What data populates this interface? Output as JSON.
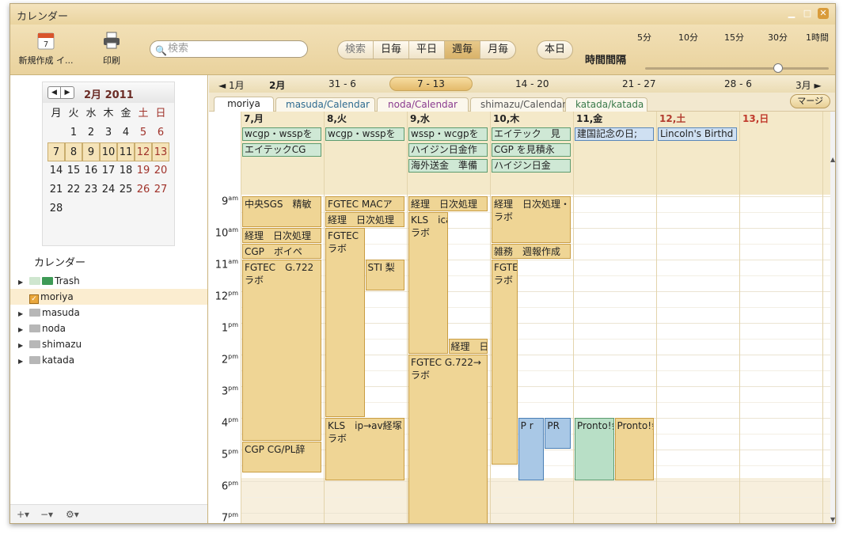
{
  "window": {
    "title": "カレンダー"
  },
  "toolbar": {
    "new_label": "新規作成 イ...",
    "new_icon_day": "7",
    "print_label": "印刷",
    "search_placeholder": "検索",
    "view_buttons": [
      "検索",
      "日毎",
      "平日",
      "週毎",
      "月毎"
    ],
    "active_view": "週毎",
    "today_label": "本日",
    "interval_label": "時間間隔",
    "interval_ticks": [
      "5分",
      "10分",
      "15分",
      "30分",
      "1時間"
    ],
    "interval_selected": "30分"
  },
  "mini_calendar": {
    "title": "2月  2011",
    "weekdays": [
      "月",
      "火",
      "水",
      "木",
      "金",
      "土",
      "日"
    ],
    "weeks": [
      [
        "",
        "1",
        "2",
        "3",
        "4",
        "5",
        "6"
      ],
      [
        "7",
        "8",
        "9",
        "10",
        "11",
        "12",
        "13"
      ],
      [
        "14",
        "15",
        "16",
        "17",
        "18",
        "19",
        "20"
      ],
      [
        "21",
        "22",
        "23",
        "24",
        "25",
        "26",
        "27"
      ],
      [
        "28",
        "",
        "",
        "",
        "",
        "",
        ""
      ]
    ],
    "selected_week_index": 1
  },
  "calendars_section": {
    "title": "カレンダー",
    "items": [
      "Trash",
      "moriya",
      "masuda",
      "noda",
      "shimazu",
      "katada"
    ]
  },
  "week_nav": {
    "prev_month": "◄ 1月",
    "month": "2月",
    "weeks": [
      "31 - 6",
      "7 - 13",
      "14 - 20",
      "21 - 27",
      "28 - 6"
    ],
    "current_week": "7 - 13",
    "next_month": "3月 ►"
  },
  "calendar_tabs": [
    "moriya",
    "masuda/Calendar",
    "noda/Calendar",
    "shimazu/Calendar",
    "katada/katada"
  ],
  "merge_label": "マージ",
  "days": [
    "7,月",
    "8,火",
    "9,水",
    "10,木",
    "11,金",
    "12,土",
    "13,日"
  ],
  "hours": [
    "9am",
    "10am",
    "11am",
    "12pm",
    "1pm",
    "2pm",
    "3pm",
    "4pm",
    "5pm",
    "6pm",
    "7pm"
  ],
  "all_day_events": [
    {
      "day": 0,
      "row": 0,
      "title": "wcgp・wsspを",
      "color": "green"
    },
    {
      "day": 0,
      "row": 1,
      "title": "エイテックCG",
      "color": "green"
    },
    {
      "day": 1,
      "row": 0,
      "title": "wcgp・wsspを",
      "color": "green"
    },
    {
      "day": 2,
      "row": 0,
      "title": "wssp・wcgpを",
      "color": "green"
    },
    {
      "day": 2,
      "row": 1,
      "title": "ハイジン日金作",
      "color": "green"
    },
    {
      "day": 2,
      "row": 2,
      "title": "海外送金　準備",
      "color": "green"
    },
    {
      "day": 3,
      "row": 0,
      "title": "エイテック　見",
      "color": "green"
    },
    {
      "day": 3,
      "row": 1,
      "title": "CGP を見積永",
      "color": "green"
    },
    {
      "day": 3,
      "row": 2,
      "title": "ハイジン日金",
      "color": "green"
    },
    {
      "day": 4,
      "row": 0,
      "title": "建国記念の日;",
      "color": "blue"
    },
    {
      "day": 5,
      "row": 0,
      "title": "Lincoln's Birthd",
      "color": "blue"
    }
  ],
  "events": [
    {
      "day": 0,
      "start": 9.0,
      "end": 10.0,
      "col": 0,
      "cols": 1,
      "title": "中央SGS　精敏",
      "body": "",
      "color": "gold"
    },
    {
      "day": 0,
      "start": 10.0,
      "end": 10.5,
      "col": 0,
      "cols": 1,
      "title": "経理　日次処理",
      "body": "",
      "color": "gold"
    },
    {
      "day": 0,
      "start": 10.5,
      "end": 11.0,
      "col": 0,
      "cols": 1,
      "title": "CGP　ボイペ",
      "body": "",
      "color": "gold"
    },
    {
      "day": 0,
      "start": 11.0,
      "end": 16.75,
      "col": 0,
      "cols": 1,
      "title": "FGTEC　G.722",
      "body": "ラボ",
      "color": "gold"
    },
    {
      "day": 0,
      "start": 16.75,
      "end": 17.75,
      "col": 0,
      "cols": 1,
      "title": "CGP CG/PL辞",
      "body": "",
      "color": "gold"
    },
    {
      "day": 1,
      "start": 9.0,
      "end": 9.5,
      "col": 0,
      "cols": 1,
      "title": "FGTEC MACア",
      "body": "",
      "color": "gold"
    },
    {
      "day": 1,
      "start": 9.5,
      "end": 10.0,
      "col": 0,
      "cols": 1,
      "title": "経理　日次処理",
      "body": "",
      "color": "gold"
    },
    {
      "day": 1,
      "start": 10.0,
      "end": 16.0,
      "col": 0,
      "cols": 2,
      "title": "FGTEC",
      "body": "ラボ",
      "color": "gold"
    },
    {
      "day": 1,
      "start": 11.0,
      "end": 12.0,
      "col": 1,
      "cols": 2,
      "title": "STI 梨",
      "body": "",
      "color": "gold"
    },
    {
      "day": 1,
      "start": 16.0,
      "end": 18.0,
      "col": 0,
      "cols": 1,
      "title": "KLS　ip→av経塚",
      "body": "ラボ",
      "color": "gold"
    },
    {
      "day": 2,
      "start": 9.0,
      "end": 9.5,
      "col": 0,
      "cols": 1,
      "title": "経理　日次処理",
      "body": "",
      "color": "gold"
    },
    {
      "day": 2,
      "start": 9.5,
      "end": 14.0,
      "col": 0,
      "cols": 2,
      "title": "KLS　ica",
      "body": "ラボ",
      "color": "gold"
    },
    {
      "day": 2,
      "start": 13.5,
      "end": 14.0,
      "col": 1,
      "cols": 2,
      "title": "経理　日",
      "body": "",
      "color": "gold"
    },
    {
      "day": 2,
      "start": 14.0,
      "end": 19.5,
      "col": 0,
      "cols": 1,
      "title": "FGTEC G.722→",
      "body": "ラボ",
      "color": "gold"
    },
    {
      "day": 3,
      "start": 9.0,
      "end": 10.5,
      "col": 0,
      "cols": 1,
      "title": "経理　日次処理・",
      "body": "ラボ",
      "color": "gold"
    },
    {
      "day": 3,
      "start": 10.5,
      "end": 11.0,
      "col": 0,
      "cols": 1,
      "title": "雑務　週報作成",
      "body": "",
      "color": "gold"
    },
    {
      "day": 3,
      "start": 11.0,
      "end": 17.5,
      "col": 0,
      "cols": 3,
      "title": "FGTE",
      "body": "ラボ",
      "color": "gold"
    },
    {
      "day": 3,
      "start": 16.0,
      "end": 18.0,
      "col": 1,
      "cols": 3,
      "title": "P r",
      "body": "",
      "color": "blue"
    },
    {
      "day": 3,
      "start": 16.0,
      "end": 17.0,
      "col": 2,
      "cols": 3,
      "title": "PR",
      "body": "",
      "color": "blue"
    },
    {
      "day": 4,
      "start": 16.0,
      "end": 18.0,
      "col": 0,
      "cols": 2,
      "title": "Pronto!会",
      "body": "",
      "color": "green"
    },
    {
      "day": 4,
      "start": 16.0,
      "end": 18.0,
      "col": 1,
      "cols": 2,
      "title": "Pronto!会",
      "body": "",
      "color": "gold"
    }
  ]
}
